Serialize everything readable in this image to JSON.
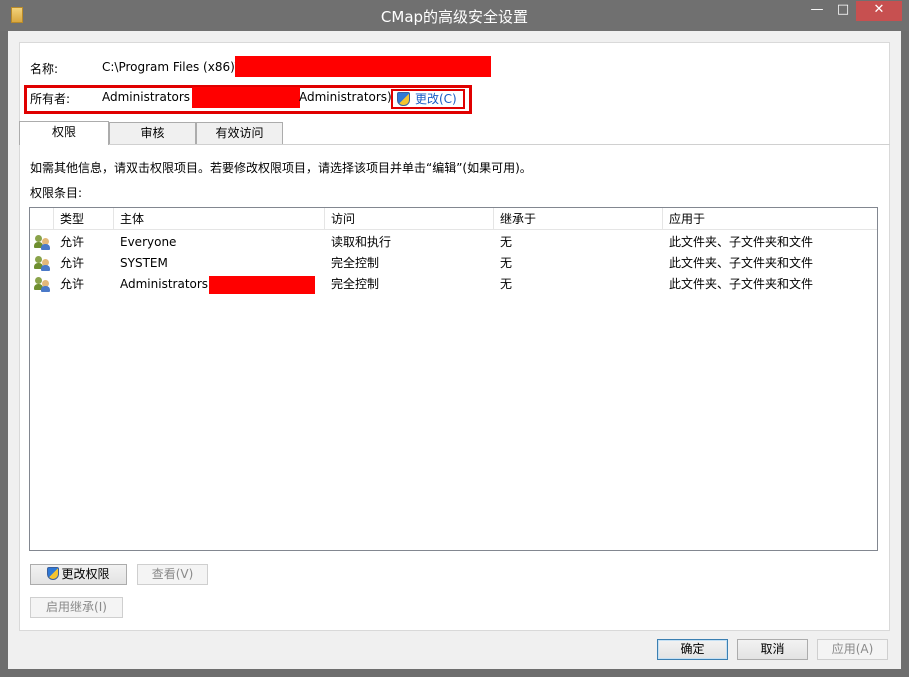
{
  "window": {
    "title": "CMap的高级安全设置",
    "controls": {
      "minimize": "—",
      "maximize": "□",
      "close": "✕"
    }
  },
  "name_row": {
    "label": "名称:",
    "value": "C:\\Program Files (x86)\\"
  },
  "owner_row": {
    "label": "所有者:",
    "value_prefix": "Administrators",
    "value_suffix": "Administrators)",
    "change_link": "更改(C)"
  },
  "tabs": [
    {
      "label": "权限",
      "active": true
    },
    {
      "label": "审核",
      "active": false
    },
    {
      "label": "有效访问",
      "active": false
    }
  ],
  "info_text": "如需其他信息，请双击权限项目。若要修改权限项目，请选择该项目并单击“编辑”(如果可用)。",
  "entries_label": "权限条目:",
  "list": {
    "columns": [
      "类型",
      "主体",
      "访问",
      "继承于",
      "应用于"
    ],
    "rows": [
      {
        "type": "允许",
        "principal": "Everyone",
        "access": "读取和执行",
        "inherited": "无",
        "applies": "此文件夹、子文件夹和文件"
      },
      {
        "type": "允许",
        "principal": "SYSTEM",
        "access": "完全控制",
        "inherited": "无",
        "applies": "此文件夹、子文件夹和文件"
      },
      {
        "type": "允许",
        "principal": "Administrators",
        "access": "完全控制",
        "inherited": "无",
        "applies": "此文件夹、子文件夹和文件"
      }
    ]
  },
  "buttons": {
    "change_permissions": "更改权限",
    "view": "查看(V)",
    "enable_inheritance": "启用继承(I)",
    "ok": "确定",
    "cancel": "取消",
    "apply": "应用(A)"
  },
  "colors": {
    "redaction": "#ff0000",
    "link": "#1a5dc5",
    "highlight_border": "#e00000"
  }
}
